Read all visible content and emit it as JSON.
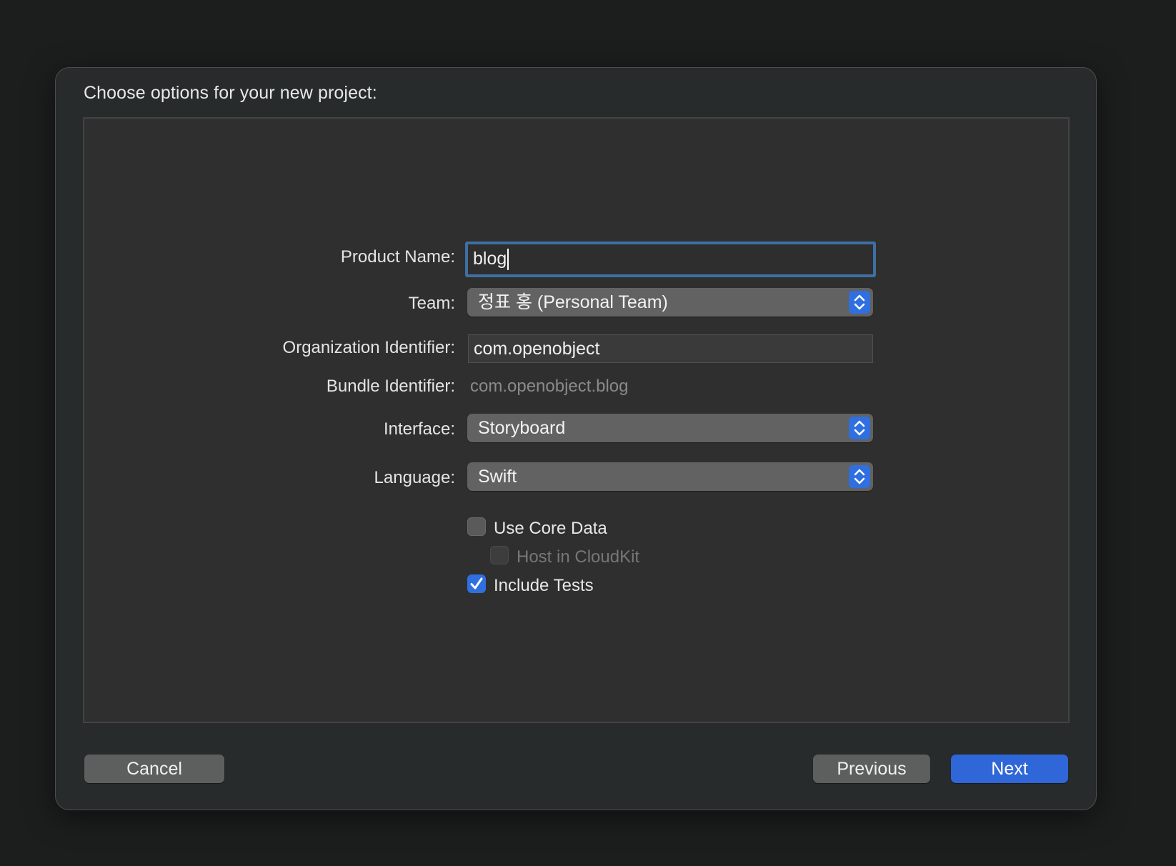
{
  "dialog": {
    "title": "Choose options for your new project:"
  },
  "form": {
    "product_name": {
      "label": "Product Name:",
      "value": "blog"
    },
    "team": {
      "label": "Team:",
      "value": "정표 홍 (Personal Team)"
    },
    "organization_identifier": {
      "label": "Organization Identifier:",
      "value": "com.openobject"
    },
    "bundle_identifier": {
      "label": "Bundle Identifier:",
      "value": "com.openobject.blog"
    },
    "interface": {
      "label": "Interface:",
      "value": "Storyboard"
    },
    "language": {
      "label": "Language:",
      "value": "Swift"
    },
    "use_core_data": {
      "label": "Use Core Data",
      "checked": false
    },
    "host_in_cloudkit": {
      "label": "Host in CloudKit",
      "checked": false,
      "enabled": false
    },
    "include_tests": {
      "label": "Include Tests",
      "checked": true
    }
  },
  "buttons": {
    "cancel": "Cancel",
    "previous": "Previous",
    "next": "Next"
  },
  "colors": {
    "accent": "#2f6fe0",
    "focus_ring": "#3f6fa3",
    "background": "#1c1e1e"
  },
  "icons": {
    "popup_arrows": "chevron-up-down-icon",
    "checkmark": "checkmark-icon"
  }
}
